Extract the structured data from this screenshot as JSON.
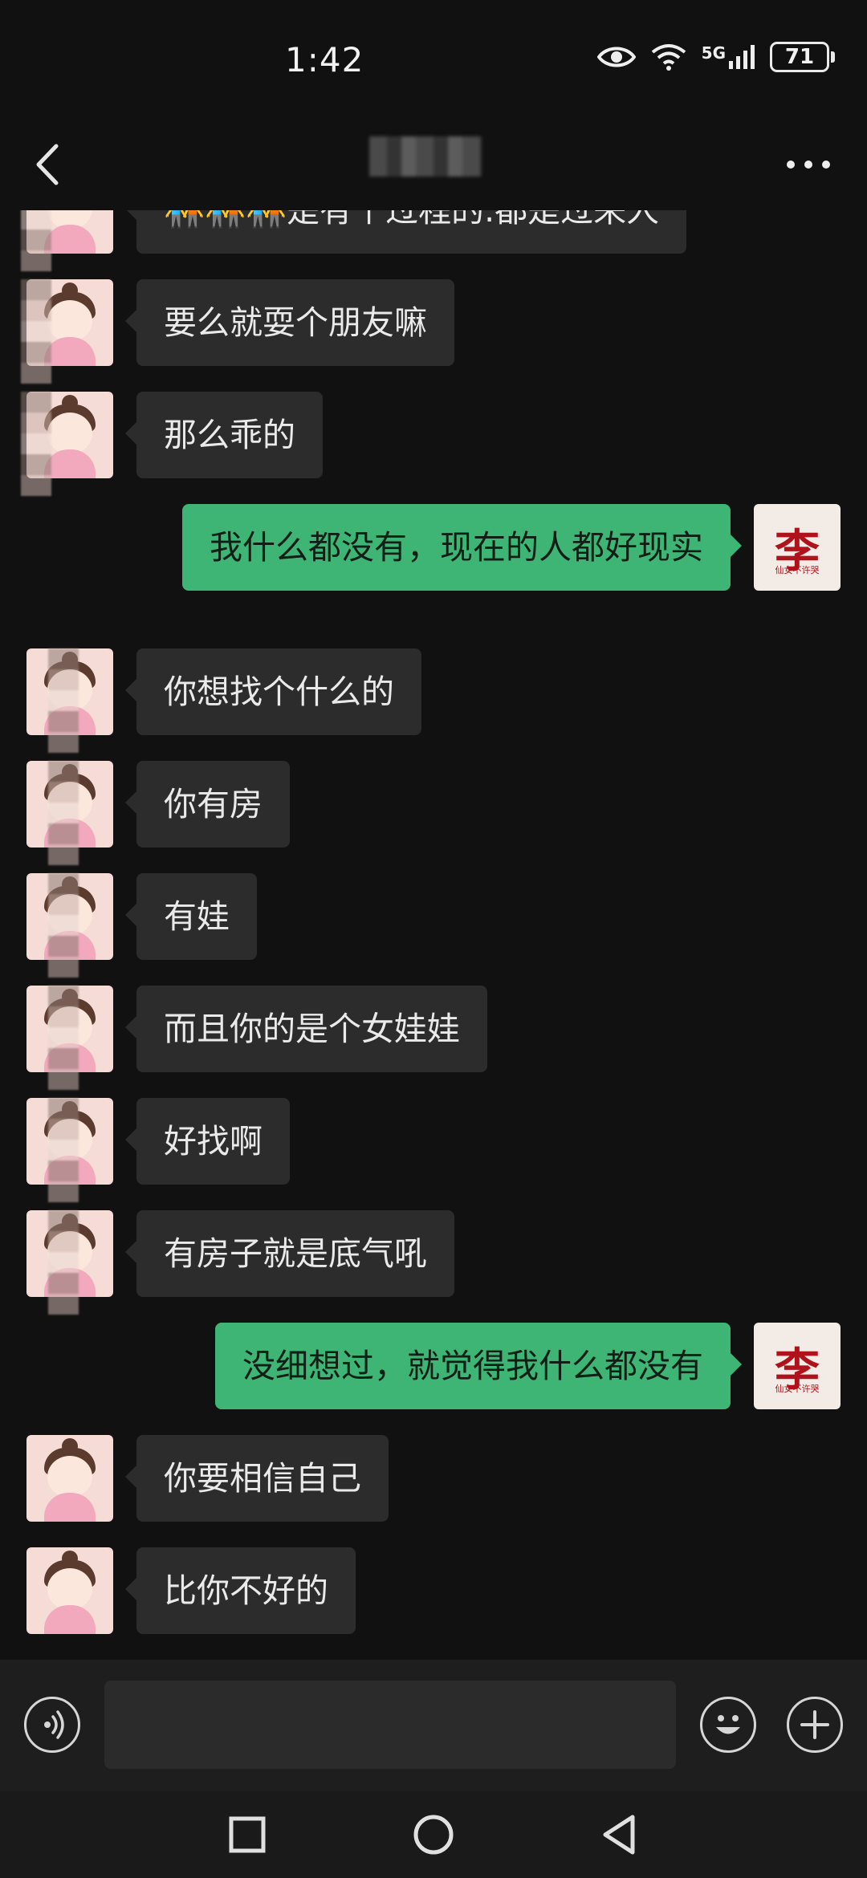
{
  "status_bar": {
    "time": "1:42",
    "network": "5G",
    "battery": "71",
    "icons": [
      "eye-icon",
      "wifi-icon",
      "signal-icon",
      "battery-icon"
    ]
  },
  "header": {
    "icons": [
      "back-chevron-icon",
      "more-icon"
    ]
  },
  "colors": {
    "background": "#111111",
    "received_bubble": "#2c2c2c",
    "sent_bubble": "#3eb575",
    "input_bar": "#1e1e1e"
  },
  "messages": [
    {
      "side": "left",
      "text": "🧑‍🤝‍🧑🧑‍🤝‍🧑🧑‍🤝‍🧑是有个过程的.都是过来人"
    },
    {
      "side": "left",
      "text": "要么就耍个朋友嘛"
    },
    {
      "side": "left",
      "text": "那么乖的"
    },
    {
      "side": "right",
      "text": "我什么都没有，现在的人都好现实"
    },
    {
      "side": "left",
      "text": "你想找个什么的"
    },
    {
      "side": "left",
      "text": "你有房"
    },
    {
      "side": "left",
      "text": "有娃"
    },
    {
      "side": "left",
      "text": "而且你的是个女娃娃"
    },
    {
      "side": "left",
      "text": "好找啊"
    },
    {
      "side": "left",
      "text": "有房子就是底气吼"
    },
    {
      "side": "right",
      "text": "没细想过，就觉得我什么都没有"
    },
    {
      "side": "left",
      "text": "你要相信自己"
    },
    {
      "side": "left",
      "text": "比你不好的"
    }
  ],
  "my_avatar": {
    "char": "李",
    "sub": "仙女不许哭"
  },
  "input_bar": {
    "value": "",
    "icons": [
      "voice-icon",
      "emoji-icon",
      "plus-icon"
    ]
  },
  "nav_bar": {
    "icons": [
      "recent-apps-icon",
      "home-icon",
      "back-icon"
    ]
  }
}
